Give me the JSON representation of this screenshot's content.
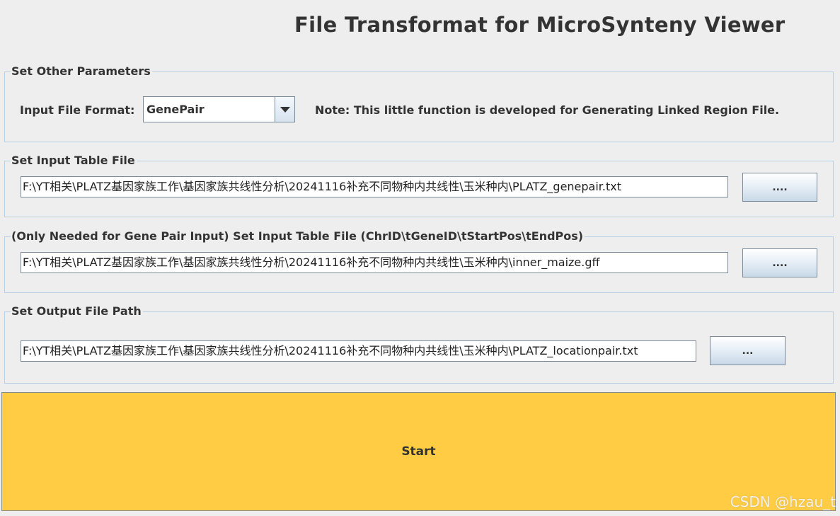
{
  "window": {
    "title": "File Transformat for MicroSynteny Viewer"
  },
  "params_panel": {
    "legend": "Set Other Parameters",
    "format_label": "Input File Format:",
    "format_selected": "GenePair",
    "note": "Note: This little function is developed for Generating Linked Region File."
  },
  "input_panel": {
    "legend": "Set Input Table File",
    "path": "F:\\YT相关\\PLATZ基因家族工作\\基因家族共线性分析\\20241116补充不同物种内共线性\\玉米种内\\PLATZ_genepair.txt",
    "browse_label": "...."
  },
  "gff_panel": {
    "legend": "(Only Needed for Gene Pair Input) Set Input Table File (ChrID\\tGeneID\\tStartPos\\tEndPos)",
    "path": "F:\\YT相关\\PLATZ基因家族工作\\基因家族共线性分析\\20241116补充不同物种内共线性\\玉米种内\\inner_maize.gff",
    "browse_label": "...."
  },
  "output_panel": {
    "legend": "Set Output File Path",
    "path": "F:\\YT相关\\PLATZ基因家族工作\\基因家族共线性分析\\20241116补充不同物种内共线性\\玉米种内\\PLATZ_locationpair.txt",
    "browse_label": "..."
  },
  "start_button": {
    "label": "Start",
    "color": "#ffcc44"
  },
  "watermark": "CSDN @hzau_t",
  "colors": {
    "background": "#eeeeee",
    "panel_border": "#b8cfe5"
  }
}
